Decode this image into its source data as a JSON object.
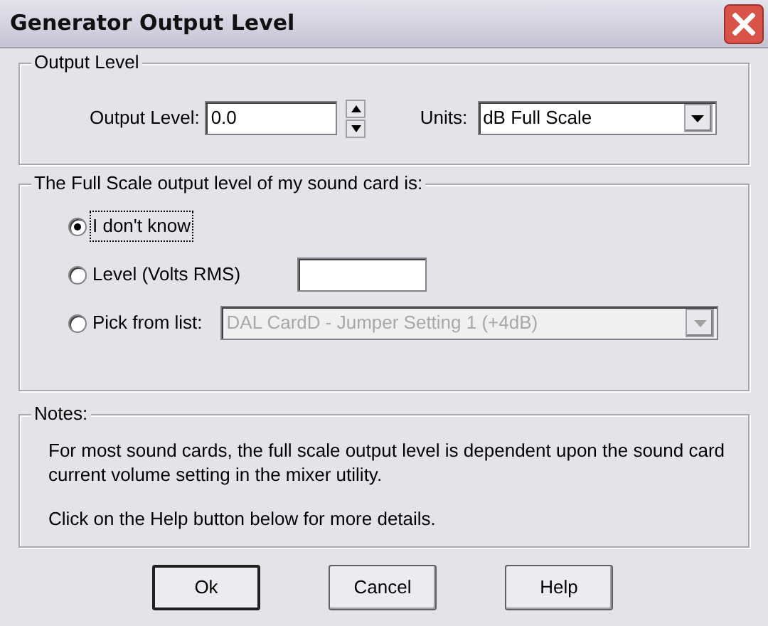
{
  "window": {
    "title": "Generator Output Level"
  },
  "output_group": {
    "title": "Output Level",
    "level_label": "Output Level:",
    "level_value": "0.0",
    "units_label": "Units:",
    "units_value": "dB Full Scale"
  },
  "scale_group": {
    "title": "The Full Scale output level of my sound card is:",
    "options": [
      {
        "label": "I don't know",
        "selected": true,
        "focused": true,
        "kind": "plain"
      },
      {
        "label": "Level (Volts RMS)",
        "selected": false,
        "focused": false,
        "kind": "field"
      },
      {
        "label": "Pick from list:",
        "selected": false,
        "focused": false,
        "kind": "dropdown",
        "value": "DAL CardD - Jumper Setting 1 (+4dB)",
        "disabled": true
      }
    ]
  },
  "notes": {
    "title": "Notes:",
    "paragraphs": [
      "For most sound cards, the full scale output level is dependent upon the sound card current volume setting in the mixer utility.",
      "Click on the Help button below for more details."
    ]
  },
  "buttons": [
    {
      "label": "Ok",
      "default": true
    },
    {
      "label": "Cancel",
      "default": false
    },
    {
      "label": "Help",
      "default": false
    }
  ]
}
